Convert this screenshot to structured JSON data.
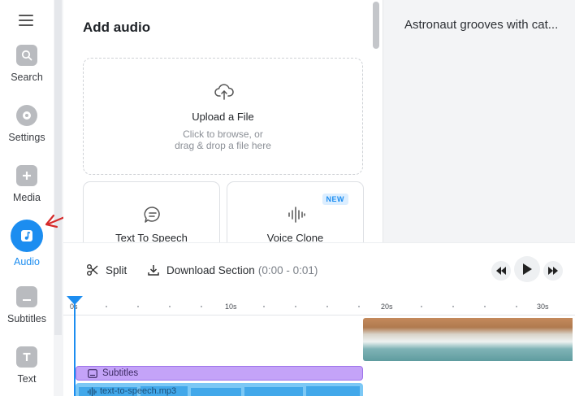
{
  "sidebar": {
    "menu_icon": "hamburger-icon",
    "items": [
      {
        "label": "Search",
        "icon": "search-icon"
      },
      {
        "label": "Settings",
        "icon": "settings-icon"
      },
      {
        "label": "Media",
        "icon": "plus-icon"
      },
      {
        "label": "Audio",
        "icon": "music-note-icon",
        "active": true
      },
      {
        "label": "Subtitles",
        "icon": "subtitles-icon"
      },
      {
        "label": "Text",
        "icon": "text-icon"
      }
    ]
  },
  "panel": {
    "title": "Add audio",
    "upload": {
      "title": "Upload a File",
      "subtitle_line1": "Click to browse, or",
      "subtitle_line2": "drag & drop a file here",
      "icon": "upload-cloud-icon"
    },
    "cards": [
      {
        "label": "Text To Speech",
        "icon": "speech-bubble-icon"
      },
      {
        "label": "Voice Clone",
        "icon": "waveform-icon",
        "badge": "NEW"
      }
    ]
  },
  "preview": {
    "title": "Astronaut grooves with cat..."
  },
  "toolbar": {
    "split_label": "Split",
    "download_label": "Download Section",
    "download_range": "(0:00 - 0:01)",
    "rewind_icon": "rewind-icon",
    "play_icon": "play-icon",
    "forward_icon": "fast-forward-icon"
  },
  "timeline": {
    "ticks": [
      "0s",
      "10s",
      "20s",
      "30s"
    ],
    "subtitle_track_label": "Subtitles",
    "audio_track_label": "text-to-speech.mp3"
  },
  "colors": {
    "accent": "#1c8df0",
    "subtitle_track": "#c4a3f8",
    "audio_track": "#7cc8f5",
    "annotation_arrow": "#d62b2b"
  }
}
